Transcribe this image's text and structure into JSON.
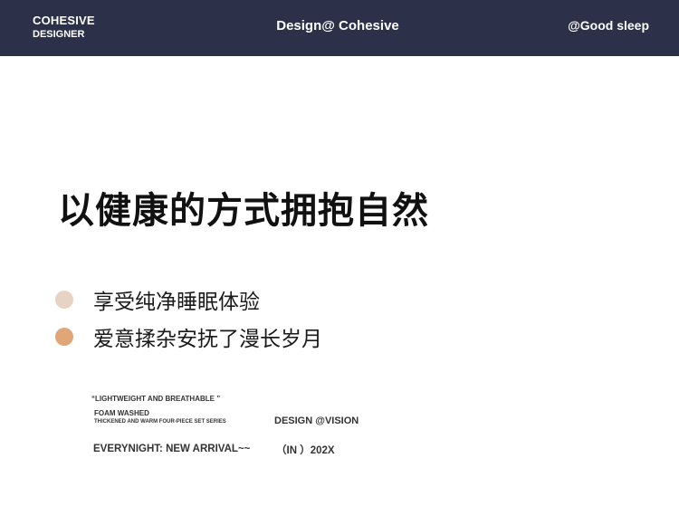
{
  "header": {
    "brand_line1": "COHESIVE",
    "brand_line2": "DESIGNER",
    "center_title": "Design@ Cohesive",
    "right_tag": "@Good sleep",
    "background": "#2c3049"
  },
  "main": {
    "headline": "以健康的方式拥抱自然",
    "bullets": [
      {
        "text": "享受纯净睡眠体验",
        "dot_color": "#e7d3c4"
      },
      {
        "text": "爱意揉杂安抚了漫长岁月",
        "dot_color": "#e0a677"
      }
    ]
  },
  "footer_text": {
    "quote": "“LIGHTWEIGHT AND BREATHABLE ”",
    "foam": "FOAM WASHED",
    "series": "THICKENED AND WARM FOUR-PIECE SET SERIES",
    "vision": "DESIGN @VISION",
    "arrival": "EVERYNIGHT: NEW ARRIVAL~~",
    "year": "（IN ）202X"
  }
}
